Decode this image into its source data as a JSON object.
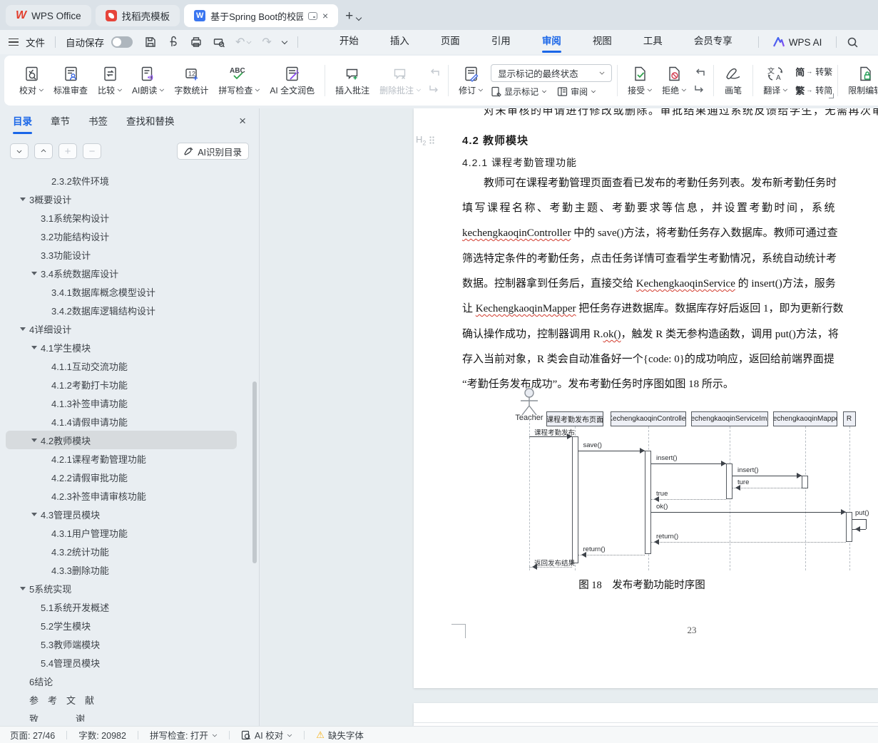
{
  "tabbar": {
    "home_tab": "WPS Office",
    "docer_tab": "找稻壳模板",
    "doc_tab": "基于Spring Boot的校园学生"
  },
  "menubar": {
    "file": "文件",
    "autosave": "自动保存",
    "tabs": [
      "开始",
      "插入",
      "页面",
      "引用",
      "审阅",
      "视图",
      "工具",
      "会员专享"
    ],
    "ai": "WPS AI"
  },
  "ribbon": {
    "proof": "校对",
    "standard": "标准审查",
    "compare": "比较",
    "read": "AI朗读",
    "wordcount": "字数统计",
    "wordcount_glyph": "12",
    "spell": "拼写检查",
    "spell_glyph": "ABC",
    "polish": "AI 全文润色",
    "insert_comment": "插入批注",
    "delete_comment": "删除批注",
    "revise": "修订",
    "markup_state": "显示标记的最终状态",
    "show_markup": "显示标记",
    "review_pane": "审阅",
    "accept": "接受",
    "reject": "拒绝",
    "pen": "画笔",
    "translate": "翻译",
    "jian": "简",
    "fan": "繁",
    "to_trad": "转繁",
    "to_simp": "转简",
    "restrict": "限制编辑"
  },
  "sidebar": {
    "tabs": [
      "目录",
      "章节",
      "书签",
      "查找和替换"
    ],
    "ai_button": "AI识别目录",
    "toc": [
      {
        "label": "2.3.2软件环境",
        "level": 3
      },
      {
        "label": "3概要设计",
        "level": 1,
        "caret": true
      },
      {
        "label": "3.1系统架构设计",
        "level": 2
      },
      {
        "label": "3.2功能结构设计",
        "level": 2
      },
      {
        "label": "3.3功能设计",
        "level": 2
      },
      {
        "label": "3.4系统数据库设计",
        "level": 2,
        "caret": true
      },
      {
        "label": "3.4.1数据库概念模型设计",
        "level": 3
      },
      {
        "label": "3.4.2数据库逻辑结构设计",
        "level": 3
      },
      {
        "label": "4详细设计",
        "level": 1,
        "caret": true
      },
      {
        "label": "4.1学生模块",
        "level": 2,
        "caret": true
      },
      {
        "label": "4.1.1互动交流功能",
        "level": 3
      },
      {
        "label": "4.1.2考勤打卡功能",
        "level": 3
      },
      {
        "label": "4.1.3补签申请功能",
        "level": 3
      },
      {
        "label": "4.1.4请假申请功能",
        "level": 3
      },
      {
        "label": "4.2教师模块",
        "level": 2,
        "caret": true,
        "selected": true
      },
      {
        "label": "4.2.1课程考勤管理功能",
        "level": 3
      },
      {
        "label": "4.2.2请假审批功能",
        "level": 3
      },
      {
        "label": "4.2.3补签申请审核功能",
        "level": 3
      },
      {
        "label": "4.3管理员模块",
        "level": 2,
        "caret": true
      },
      {
        "label": "4.3.1用户管理功能",
        "level": 3
      },
      {
        "label": "4.3.2统计功能",
        "level": 3
      },
      {
        "label": "4.3.3删除功能",
        "level": 3
      },
      {
        "label": "5系统实现",
        "level": 1,
        "caret": true
      },
      {
        "label": "5.1系统开发概述",
        "level": 2
      },
      {
        "label": "5.2学生模块",
        "level": 2
      },
      {
        "label": "5.3教师端模块",
        "level": 2
      },
      {
        "label": "5.4管理员模块",
        "level": 2
      },
      {
        "label": "6结论",
        "level": 1
      },
      {
        "label": "参　考　文　献",
        "level": 1
      },
      {
        "label": "致　　　　谢",
        "level": 1
      }
    ]
  },
  "document": {
    "clipped_line": "对未审核的申请进行修改或删除。审批结果通过系统反馈给学生，无需再次审核流程",
    "heading_marker": "H2",
    "heading2": "4.2 教师模块",
    "heading3": "4.2.1 课程考勤管理功能",
    "lines": [
      {
        "indent": true,
        "runs": [
          {
            "t": "教师可在课程考勤管理页面查看已发布的考勤任务列表。发布新考勤任务时"
          }
        ]
      },
      {
        "sp": true,
        "runs": [
          {
            "t": "填写课程名称、考勤主题、考勤要求等信息，并设置考勤时间，系统"
          }
        ]
      },
      {
        "runs": [
          {
            "t": "kechengkaoqinController",
            "wavy": true
          },
          {
            "t": " 中的 save()方法，将考勤任务存入数据库。教师可通过查"
          }
        ]
      },
      {
        "runs": [
          {
            "t": "筛选特定条件的考勤任务，点击任务详情可查看学生考勤情况，系统自动统计考"
          }
        ]
      },
      {
        "runs": [
          {
            "t": "数据。控制器拿到任务后，直接交给 "
          },
          {
            "t": "KechengkaoqinService",
            "wavy": true
          },
          {
            "t": " 的 insert()方法，服务"
          }
        ]
      },
      {
        "runs": [
          {
            "t": "让 "
          },
          {
            "t": "KechengkaoqinMapper",
            "wavy": true
          },
          {
            "t": " 把任务存进数据库。数据库存好后返回 1，即为更新行数"
          }
        ]
      },
      {
        "runs": [
          {
            "t": "确认操作成功，控制器调用 R."
          },
          {
            "t": "ok()",
            "wavy": true
          },
          {
            "t": "，触发 R 类无参构造函数，调用 put()方法，将"
          }
        ]
      },
      {
        "runs": [
          {
            "t": "存入当前对象，R 类会自动准备好一个{code: 0}的成功响应，返回给前端界面提"
          }
        ]
      },
      {
        "runs": [
          {
            "t": "“考勤任务发布成功”。发布考勤任务时序图如图 18 所示。"
          }
        ]
      }
    ],
    "page_number": "23"
  },
  "diagram": {
    "actor": "Teacher",
    "participants": [
      "课程考勤发布页面",
      "KechengkaoqinController",
      "KechengkaoqinServiceImpl",
      "KechengkaoqinMapper",
      "R"
    ],
    "messages": [
      {
        "label": "课程考勤发布",
        "kind": "sync"
      },
      {
        "label": "save()",
        "kind": "sync"
      },
      {
        "label": "insert()",
        "kind": "sync"
      },
      {
        "label": "insert()",
        "kind": "sync"
      },
      {
        "label": "ture",
        "kind": "return"
      },
      {
        "label": "true",
        "kind": "return"
      },
      {
        "label": "ok()",
        "kind": "sync"
      },
      {
        "label": "put()",
        "kind": "self"
      },
      {
        "label": "return()",
        "kind": "return"
      },
      {
        "label": "return()",
        "kind": "return"
      },
      {
        "label": "返回发布结果",
        "kind": "return"
      }
    ],
    "caption": "图 18　发布考勤功能时序图"
  },
  "statusbar": {
    "page_label": "页面: 27/46",
    "word_label": "字数: 20982",
    "spell_label": "拼写检查: 打开",
    "ai_label": "AI 校对",
    "font_label": "缺失字体"
  }
}
